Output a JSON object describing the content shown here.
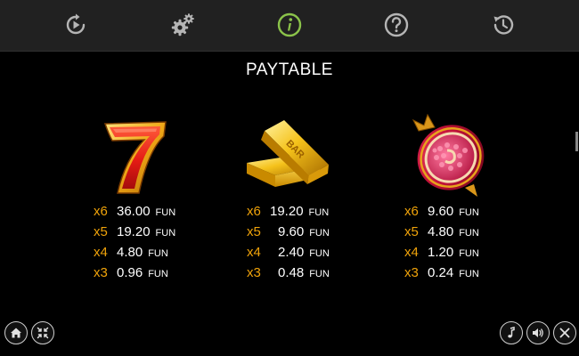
{
  "toolbar": {
    "items": [
      {
        "icon": "replay-icon",
        "active": false
      },
      {
        "icon": "settings-icon",
        "active": false
      },
      {
        "icon": "info-icon",
        "active": true
      },
      {
        "icon": "help-icon",
        "active": false
      },
      {
        "icon": "history-icon",
        "active": false
      }
    ],
    "active_color": "#8bc34a",
    "inactive_color": "#b5b5b5"
  },
  "title": "PAYTABLE",
  "symbols": [
    {
      "icon": "lucky-seven-icon",
      "pays": [
        {
          "mult": "x6",
          "amount": "36.00",
          "currency": "FUN"
        },
        {
          "mult": "x5",
          "amount": "19.20",
          "currency": "FUN"
        },
        {
          "mult": "x4",
          "amount": "4.80",
          "currency": "FUN"
        },
        {
          "mult": "x3",
          "amount": "0.96",
          "currency": "FUN"
        }
      ]
    },
    {
      "icon": "gold-bars-icon",
      "bar_text": "BAR",
      "pays": [
        {
          "mult": "x6",
          "amount": "19.20",
          "currency": "FUN"
        },
        {
          "mult": "x5",
          "amount": "9.60",
          "currency": "FUN"
        },
        {
          "mult": "x4",
          "amount": "2.40",
          "currency": "FUN"
        },
        {
          "mult": "x3",
          "amount": "0.48",
          "currency": "FUN"
        }
      ]
    },
    {
      "icon": "pomegranate-icon",
      "pays": [
        {
          "mult": "x6",
          "amount": "9.60",
          "currency": "FUN"
        },
        {
          "mult": "x5",
          "amount": "4.80",
          "currency": "FUN"
        },
        {
          "mult": "x4",
          "amount": "1.20",
          "currency": "FUN"
        },
        {
          "mult": "x3",
          "amount": "0.24",
          "currency": "FUN"
        }
      ]
    }
  ],
  "colors": {
    "multiplier": "#f0a30a",
    "text": "#ffffff",
    "background": "#000000",
    "toolbar_bg": "#212121"
  },
  "bottom_left": [
    "home-icon",
    "fullscreen-icon"
  ],
  "bottom_right": [
    "music-icon",
    "sound-icon",
    "close-icon"
  ]
}
